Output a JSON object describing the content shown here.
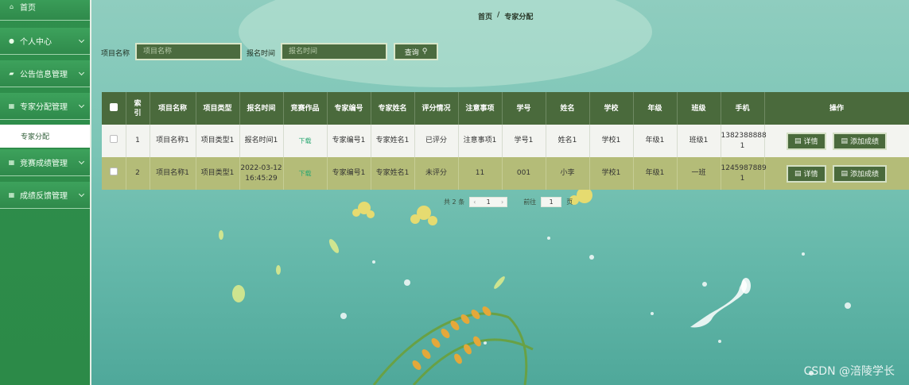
{
  "sidebar": {
    "items": [
      {
        "label": "首页",
        "icon": "home-icon"
      },
      {
        "label": "个人中心",
        "icon": "user-icon"
      },
      {
        "label": "公告信息管理",
        "icon": "notice-icon"
      },
      {
        "label": "专家分配管理",
        "icon": "grid-icon"
      },
      {
        "label": "竞赛成绩管理",
        "icon": "grid-icon"
      },
      {
        "label": "成绩反馈管理",
        "icon": "grid-icon"
      }
    ],
    "active_sub": "专家分配"
  },
  "breadcrumb": {
    "home": "首页",
    "sep": "/",
    "current": "专家分配"
  },
  "search": {
    "project_label": "项目名称",
    "project_placeholder": "项目名称",
    "time_label": "报名时间",
    "time_placeholder": "报名时间",
    "button": "查询"
  },
  "table": {
    "headers": [
      "索引",
      "项目名称",
      "项目类型",
      "报名时间",
      "竞赛作品",
      "专家编号",
      "专家姓名",
      "评分情况",
      "注意事项",
      "学号",
      "姓名",
      "学校",
      "年级",
      "班级",
      "手机",
      "操作"
    ],
    "rows": [
      {
        "index": "1",
        "name": "项目名称1",
        "type": "项目类型1",
        "time": "报名时间1",
        "work": "下载",
        "expert_no": "专家编号1",
        "expert_name": "专家姓名1",
        "score": "已评分",
        "notes": "注意事项1",
        "student_no": "学号1",
        "student_name": "姓名1",
        "school": "学校1",
        "grade": "年级1",
        "class": "班级1",
        "phone1": "1382388888",
        "phone2": "1"
      },
      {
        "index": "2",
        "name": "项目名称1",
        "type": "项目类型1",
        "time": "2022-03-12",
        "time2": "16:45:29",
        "work": "下载",
        "expert_no": "专家编号1",
        "expert_name": "专家姓名1",
        "score": "未评分",
        "notes": "11",
        "student_no": "001",
        "student_name": "小李",
        "school": "学校1",
        "grade": "年级1",
        "class": "一班",
        "phone1": "1245987889",
        "phone2": "1"
      }
    ],
    "actions": {
      "detail": "详情",
      "add_score": "添加成绩"
    }
  },
  "pager": {
    "total_prefix": "共",
    "total": "2",
    "total_suffix": "条",
    "page": "1",
    "goto_label": "前往",
    "goto_value": "1",
    "page_suffix": "页"
  },
  "watermark": "CSDN @涪陵学长",
  "colors": {
    "sidebar": "#2f8f4c",
    "header": "#4a6a3c",
    "row_alt": "#b4bc78",
    "accent_link": "#2aa772"
  }
}
